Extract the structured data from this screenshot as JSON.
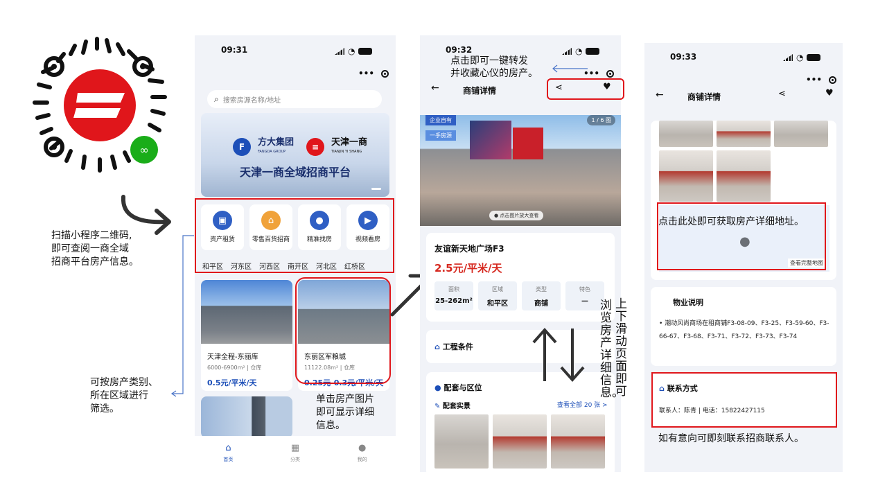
{
  "qr": {
    "icon": "mini-program-qr-code"
  },
  "captions": {
    "scan": [
      "扫描小程序二维码,",
      "即可查阅一商全域",
      "招商平台房产信息。"
    ],
    "filter": [
      "可按房产类别、",
      "所在区域进行",
      "筛选。"
    ],
    "click_image": [
      "单击房产图片",
      "即可显示详细",
      "信息。"
    ],
    "share": [
      "点击即可一键转发",
      "并收藏心仪的房产。"
    ],
    "scroll": [
      "上下滑动页面即可",
      "浏览房产详细信息。"
    ],
    "address": "点击此处即可获取房产详细地址。",
    "contact": "如有意向可即刻联系招商联系人。"
  },
  "phone1": {
    "time": "09:31",
    "search_placeholder": "搜索房源名称/地址",
    "banner": {
      "brand1": "方大集团",
      "brand1_en": "FANGDA GROUP",
      "brand2": "天津一商",
      "brand2_en": "TIANJIN YI SHANG",
      "headline": "天津一商全域招商平台"
    },
    "categories": [
      {
        "label": "资产租赁",
        "icon": "building-icon",
        "color": "#2f5fc4"
      },
      {
        "label": "零售百货招商",
        "icon": "shop-icon",
        "color": "#f0a23a"
      },
      {
        "label": "精准找房",
        "icon": "location-pin-icon",
        "color": "#2f5fc4"
      },
      {
        "label": "视频看房",
        "icon": "video-icon",
        "color": "#2f5fc4"
      }
    ],
    "districts": [
      "和平区",
      "河东区",
      "河西区",
      "南开区",
      "河北区",
      "红桥区"
    ],
    "properties": [
      {
        "title": "天津全程-东丽库",
        "sub": "6000-6900m² | 仓库",
        "price": "0.5元/平米/天"
      },
      {
        "title": "东丽区军粮城",
        "sub": "11122.08m² | 仓库",
        "price": "0.25元-0.3元/平米/天"
      }
    ],
    "tabs": [
      {
        "label": "首页",
        "icon": "home-icon"
      },
      {
        "label": "分类",
        "icon": "grid-icon"
      },
      {
        "label": "我的",
        "icon": "user-icon"
      }
    ]
  },
  "phone2": {
    "time": "09:32",
    "title": "商铺详情",
    "tag1": "企业自有",
    "tag2": "一手房源",
    "photo_count": "1 / 6 图",
    "zoom_hint": "点击图片放大查看",
    "name": "友谊新天地广场F3",
    "price": "2.5元/平米/天",
    "info": [
      {
        "k": "面积",
        "v": "25-262m²"
      },
      {
        "k": "区域",
        "v": "和平区"
      },
      {
        "k": "类型",
        "v": "商铺"
      },
      {
        "k": "特色",
        "v": "—"
      }
    ],
    "section_engineering": "工程条件",
    "section_facilities": "配套与区位",
    "section_photos": "配套实景",
    "see_all": "查看全部 20 张 >"
  },
  "phone3": {
    "time": "09:33",
    "title": "商铺详情",
    "map_button": "查看完整地图",
    "property_section": "物业说明",
    "property_text": "潮动风尚商场在租商铺F3-08-09、F3-25、F3-59-60、F3-66-67、F3-68、F3-71、F3-72、F3-73、F3-74",
    "contact_section": "联系方式",
    "contact_text": "联系人：陈青 | 电话：15822427115"
  },
  "colors": {
    "accent_red": "#e0161b",
    "brand_blue": "#1d4fb8",
    "price_red": "#d6281f"
  }
}
